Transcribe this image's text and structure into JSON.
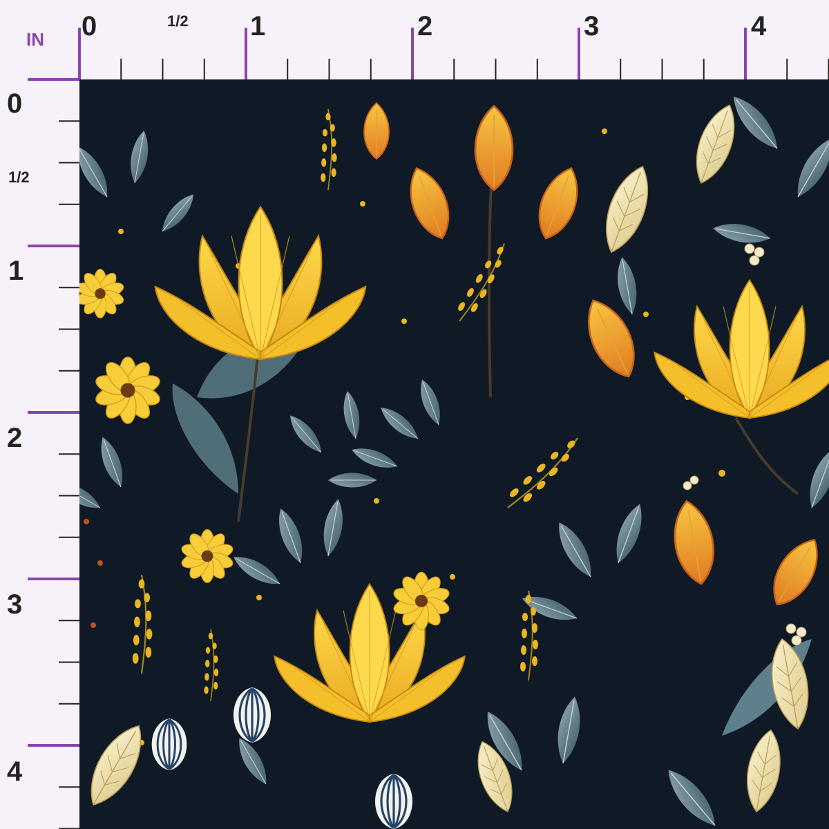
{
  "ruler": {
    "unit": "IN",
    "top_labels": [
      "0",
      "1/2",
      "1",
      "2",
      "3",
      "4"
    ],
    "left_labels": [
      "0",
      "1/2",
      "1",
      "2",
      "3",
      "4"
    ],
    "colors": {
      "background": "#f7f1fa",
      "major_tick": "#8e44ad",
      "minor_tick": "#222222",
      "text": "#222222"
    }
  },
  "fabric": {
    "description_colors": {
      "background": "#0f1a26",
      "yellow": "#f2c230",
      "orange": "#e8892a",
      "blue_grey": "#5e7f8c",
      "cream": "#f3e9bd"
    }
  }
}
